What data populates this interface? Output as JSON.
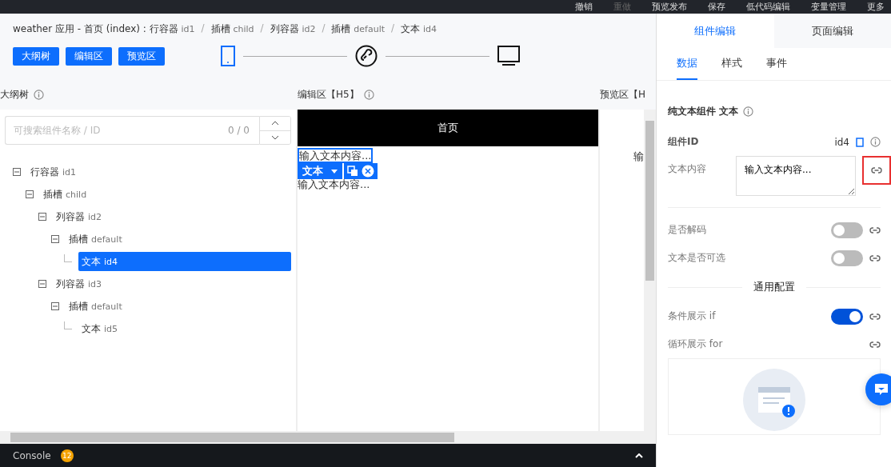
{
  "top_menu": [
    {
      "label": "撤销",
      "disabled": false
    },
    {
      "label": "重做",
      "disabled": true
    },
    {
      "label": "预览发布",
      "disabled": false
    },
    {
      "label": "保存",
      "disabled": false
    },
    {
      "label": "低代码编辑",
      "disabled": false
    },
    {
      "label": "变量管理",
      "disabled": false
    },
    {
      "label": "更多",
      "disabled": false
    }
  ],
  "breadcrumb_separator": "/",
  "breadcrumb": [
    {
      "name": "weather 应用 - 首页 (index) : 行容器",
      "id": "id1"
    },
    {
      "name": "插槽",
      "id": "child"
    },
    {
      "name": "列容器",
      "id": "id2"
    },
    {
      "name": "插槽",
      "id": "default"
    },
    {
      "name": "文本",
      "id": "id4"
    }
  ],
  "view_buttons": [
    "大纲树",
    "编辑区",
    "预览区"
  ],
  "devices": [
    {
      "kind": "phone",
      "selected": true
    },
    {
      "kind": "miniapp",
      "selected": false
    },
    {
      "kind": "desktop",
      "selected": false
    }
  ],
  "outline": {
    "title": "大纲树",
    "search": {
      "placeholder": "可搜索组件名称 / ID",
      "count": "0 / 0"
    },
    "tree": [
      {
        "name": "行容器",
        "id": "id1",
        "selected": false,
        "children": [
          {
            "name": "插槽",
            "id": "child",
            "selected": false,
            "children": [
              {
                "name": "列容器",
                "id": "id2",
                "selected": false,
                "children": [
                  {
                    "name": "插槽",
                    "id": "default",
                    "selected": false,
                    "children": [
                      {
                        "name": "文本",
                        "id": "id4",
                        "selected": true
                      }
                    ]
                  }
                ]
              },
              {
                "name": "列容器",
                "id": "id3",
                "selected": false,
                "children": [
                  {
                    "name": "插槽",
                    "id": "default",
                    "selected": false,
                    "children": [
                      {
                        "name": "文本",
                        "id": "id5",
                        "selected": false
                      }
                    ]
                  }
                ]
              }
            ]
          }
        ]
      }
    ]
  },
  "editor": {
    "title": "编辑区【H5】",
    "page_title": "首页",
    "texts": [
      "输入文本内容...",
      "输入文本内容..."
    ],
    "toolbar_label": "文本"
  },
  "preview": {
    "title": "预览区【H",
    "text": "输"
  },
  "console": {
    "label": "Console",
    "count": "12"
  },
  "panel": {
    "tabs": [
      {
        "label": "组件编辑",
        "selected": true
      },
      {
        "label": "页面编辑",
        "selected": false
      }
    ],
    "subtabs": [
      {
        "label": "数据",
        "selected": true
      },
      {
        "label": "样式",
        "selected": false
      },
      {
        "label": "事件",
        "selected": false
      }
    ],
    "component_title": "纯文本组件 文本",
    "id_label": "组件ID",
    "id_value": "id4",
    "text_label": "文本内容",
    "text_value": "输入文本内容...",
    "text_link_highlighted": true,
    "switches": [
      {
        "label": "是否解码",
        "on": false
      },
      {
        "label": "文本是否可选",
        "on": false
      }
    ],
    "section": "通用配置",
    "general": [
      {
        "label": "条件展示 if",
        "kind": "switch",
        "on": true
      },
      {
        "label": "循环展示 for",
        "kind": "empty"
      }
    ]
  }
}
